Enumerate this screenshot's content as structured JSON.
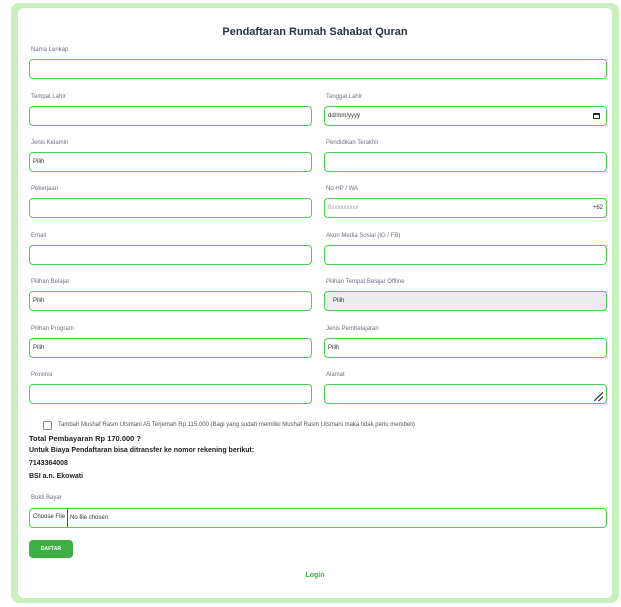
{
  "form": {
    "title": "Pendaftaran Rumah Sahabat Quran",
    "nama_label": "Nama Lenkap",
    "tempat_lahir_label": "Tempat Lahir",
    "tanggal_lahir_label": "Tanggal Lahir",
    "tanggal_lahir_placeholder": "dd/mm/yyyy",
    "jenis_kelamin_label": "Jenis Kelamin",
    "jenis_kelamin_value": "Pilih",
    "pendidikan_label": "Pendidikan Terakhir",
    "pekerjaan_label": "Pekerjaan",
    "nohp_label": "No HP / WA",
    "nohp_placeholder": "8xxxxxxxxx",
    "nohp_suffix": "+62",
    "email_label": "Email",
    "sosmed_label": "Akun Media Sosial (IG / FB)",
    "pilihan_belajar_label": "Pilihan Belajar",
    "pilihan_belajar_value": "Pilih",
    "tempat_offline_label": "Pilihan Tempat Belajar Offline",
    "tempat_offline_value": "Pilih",
    "program_label": "Pilihan Program",
    "program_value": "Pilih",
    "jenis_pembelajaran_label": "Jenis Pembelajaran",
    "jenis_pembelajaran_value": "Pilih",
    "provinsi_label": "Provinsi",
    "alamat_label": "Alamat",
    "checkbox_label": "Tambah Mushaf Rasm Utsmani A5 Terjemah Rp 115.000 (Bagi yang sudah memiliki Mushaf Rasm Utsmani maka tidak perlu membeli)",
    "total": "Total Pembayaran Rp 170.000 ?",
    "transfer_info": "Untuk Biaya Pendaftaran bisa ditransfer ke nomor rekening berikut:",
    "rekening": "7143364008",
    "bank": "BSI a.n. Ekowati",
    "bukti_label": "Bukti Bayar",
    "file_button": "Choose File",
    "file_status": "No file chosen",
    "submit": "DAFTAR",
    "login": "Login"
  },
  "colors": {
    "accent": "#3cb043",
    "border": "#4ad04a",
    "frame": "#c9f1c0"
  }
}
